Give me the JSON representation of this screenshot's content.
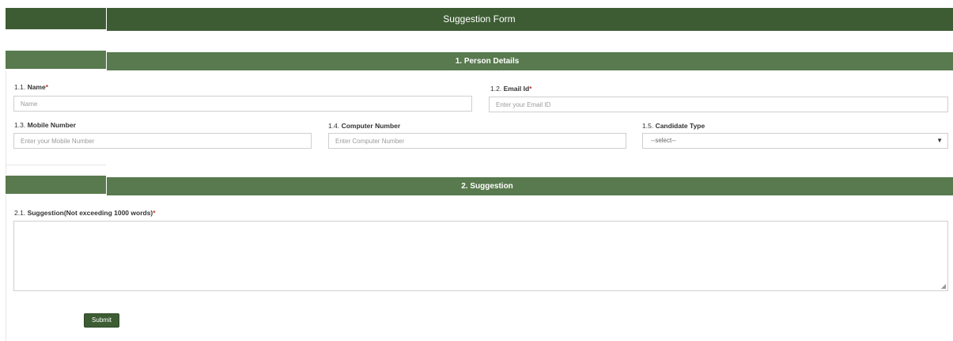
{
  "form": {
    "title": "Suggestion Form",
    "submit_label": "Submit"
  },
  "sections": [
    {
      "title": "1.  Person Details",
      "fields": {
        "name": {
          "number": "1.1.",
          "label": "Name",
          "required_mark": "*",
          "placeholder": "Name"
        },
        "email": {
          "number": "1.2.",
          "label": "Email Id",
          "required_mark": "*",
          "placeholder": "Enter your Email ID"
        },
        "mobile": {
          "number": "1.3.",
          "label": "Mobile Number",
          "placeholder": "Enter your Mobile Number"
        },
        "computer": {
          "number": "1.4.",
          "label": "Computer Number",
          "placeholder": "Enter Computer Number"
        },
        "candidate_type": {
          "number": "1.5.",
          "label": "Candidate Type",
          "selected": "--select--",
          "arrow": "▼"
        }
      }
    },
    {
      "title": "2.  Suggestion",
      "fields": {
        "suggestion": {
          "number": "2.1.",
          "label": "Suggestion(Not exceeding 1000 words)",
          "required_mark": "*"
        }
      }
    }
  ],
  "colors": {
    "title_bar": "#3d5c33",
    "section_bar": "#587a4e",
    "required": "#c0392b"
  }
}
